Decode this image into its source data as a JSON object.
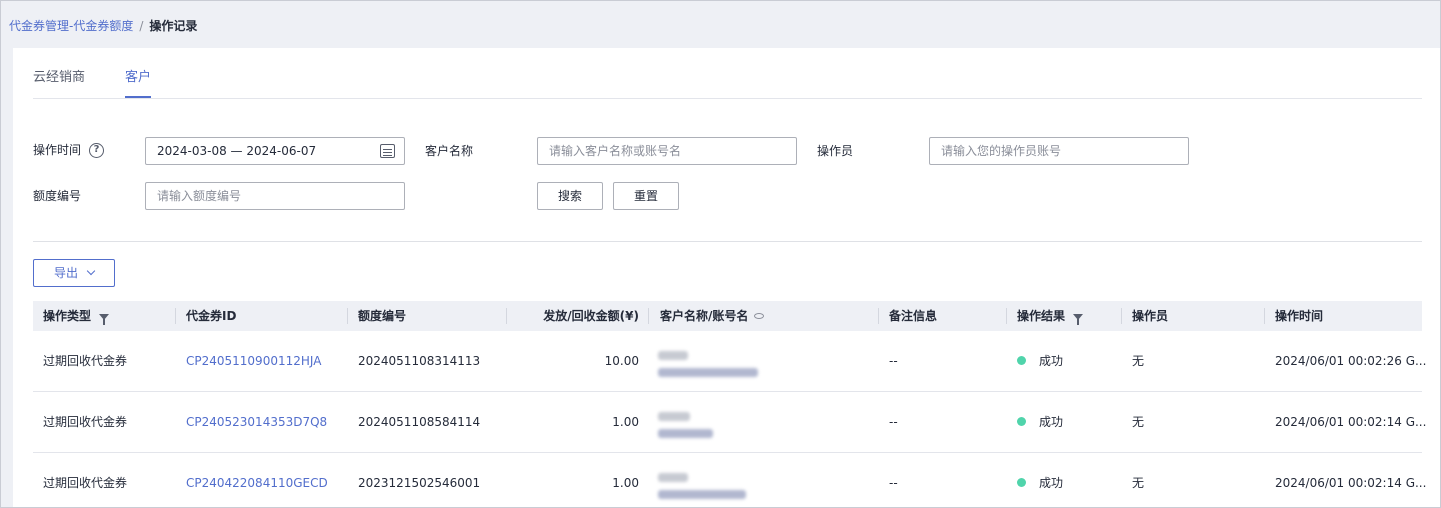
{
  "breadcrumb": {
    "parent": "代金券管理-代金券额度",
    "separator": "/",
    "current": "操作记录"
  },
  "tabs": [
    {
      "label": "云经销商"
    },
    {
      "label": "客户"
    }
  ],
  "filters": {
    "op_time_label": "操作时间",
    "help_icon": "?",
    "date_range": "2024-03-08 — 2024-06-07",
    "customer_label": "客户名称",
    "customer_placeholder": "请输入客户名称或账号名",
    "operator_label": "操作员",
    "operator_placeholder": "请输入您的操作员账号",
    "quota_label": "额度编号",
    "quota_placeholder": "请输入额度编号",
    "search_label": "搜索",
    "reset_label": "重置"
  },
  "toolbar": {
    "export_label": "导出"
  },
  "table": {
    "headers": [
      "操作类型",
      "代金券ID",
      "额度编号",
      "发放/回收金额(¥)",
      "客户名称/账号名",
      "备注信息",
      "操作结果",
      "操作员",
      "操作时间"
    ],
    "rows": [
      {
        "type": "过期回收代金券",
        "voucher_id": "CP2405110900112HJA",
        "quota_no": "2024051108314113",
        "amount": "10.00",
        "remark": "--",
        "result": "成功",
        "operator": "无",
        "time": "2024/06/01 00:02:26 G..."
      },
      {
        "type": "过期回收代金券",
        "voucher_id": "CP240523014353D7Q8",
        "quota_no": "2024051108584114",
        "amount": "1.00",
        "remark": "--",
        "result": "成功",
        "operator": "无",
        "time": "2024/06/01 00:02:14 G..."
      },
      {
        "type": "过期回收代金券",
        "voucher_id": "CP240422084110GECD",
        "quota_no": "2023121502546001",
        "amount": "1.00",
        "remark": "--",
        "result": "成功",
        "operator": "无",
        "time": "2024/06/01 00:02:14 G..."
      }
    ]
  },
  "colors": {
    "accent": "#526ecc",
    "success": "#50d4ab",
    "header_bg": "#eef0f5"
  }
}
